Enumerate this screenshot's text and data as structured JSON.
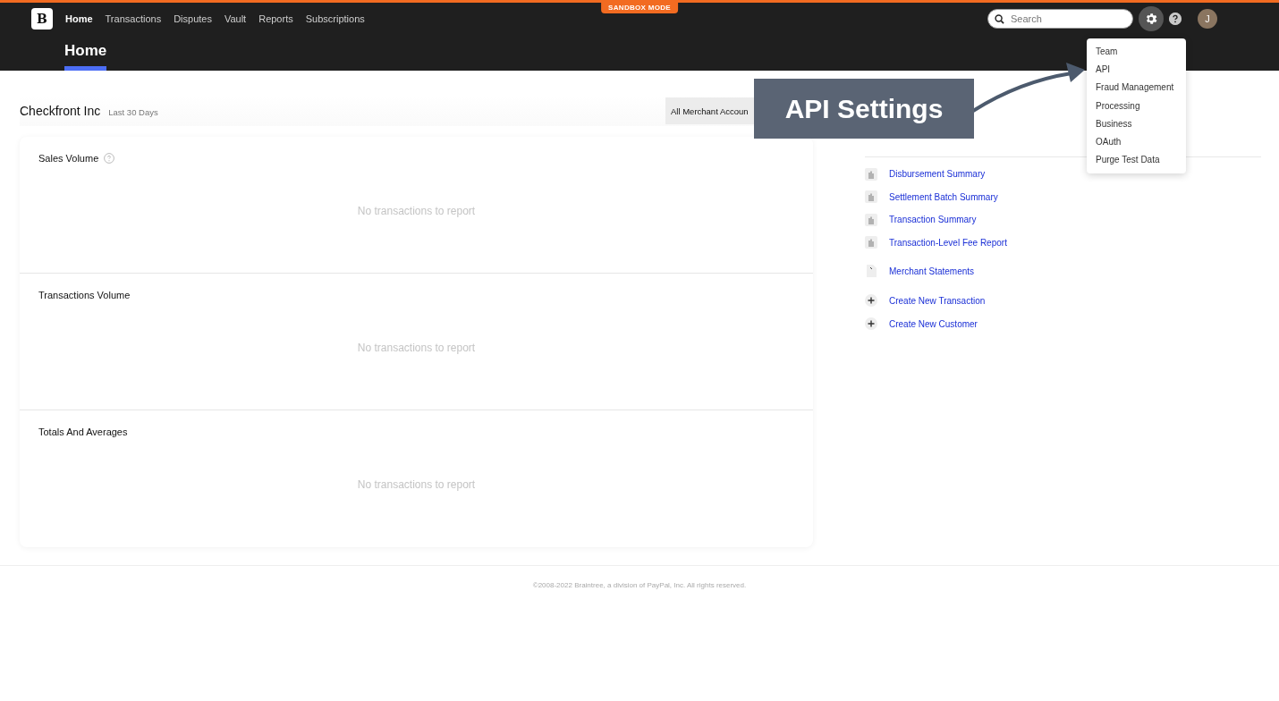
{
  "sandbox_badge": "SANDBOX MODE",
  "logo": "B",
  "nav": [
    {
      "label": "Home",
      "selected": true
    },
    {
      "label": "Transactions",
      "selected": false
    },
    {
      "label": "Disputes",
      "selected": false
    },
    {
      "label": "Vault",
      "selected": false
    },
    {
      "label": "Reports",
      "selected": false
    },
    {
      "label": "Subscriptions",
      "selected": false
    }
  ],
  "search": {
    "placeholder": "Search"
  },
  "settings_open": true,
  "avatar": "J",
  "page_title": "Home",
  "settings_menu": [
    "Team",
    "API",
    "Fraud Management",
    "Processing",
    "Business",
    "OAuth",
    "Purge Test Data"
  ],
  "account": {
    "name": "Checkfront Inc",
    "period": "Last 30 Days"
  },
  "merchant_filter": "All Merchant Accoun",
  "panels": [
    {
      "title": "Sales Volume",
      "help": true,
      "empty": "No transactions to report"
    },
    {
      "title": "Transactions Volume",
      "help": false,
      "empty": "No transactions to report"
    },
    {
      "title": "Totals And Averages",
      "help": false,
      "empty": "No transactions to report"
    }
  ],
  "quick_actions": [
    {
      "label": "Disbursement Summary",
      "kind": "report"
    },
    {
      "label": "Settlement Batch Summary",
      "kind": "report"
    },
    {
      "label": "Transaction Summary",
      "kind": "report"
    },
    {
      "label": "Transaction-Level Fee Report",
      "kind": "report"
    },
    {
      "label": "Merchant Statements",
      "kind": "statement"
    },
    {
      "label": "Create New Transaction",
      "kind": "create"
    },
    {
      "label": "Create New Customer",
      "kind": "create"
    }
  ],
  "callout": "API Settings",
  "footer": "©2008-2022 Braintree, a division of PayPal, Inc. All rights reserved."
}
